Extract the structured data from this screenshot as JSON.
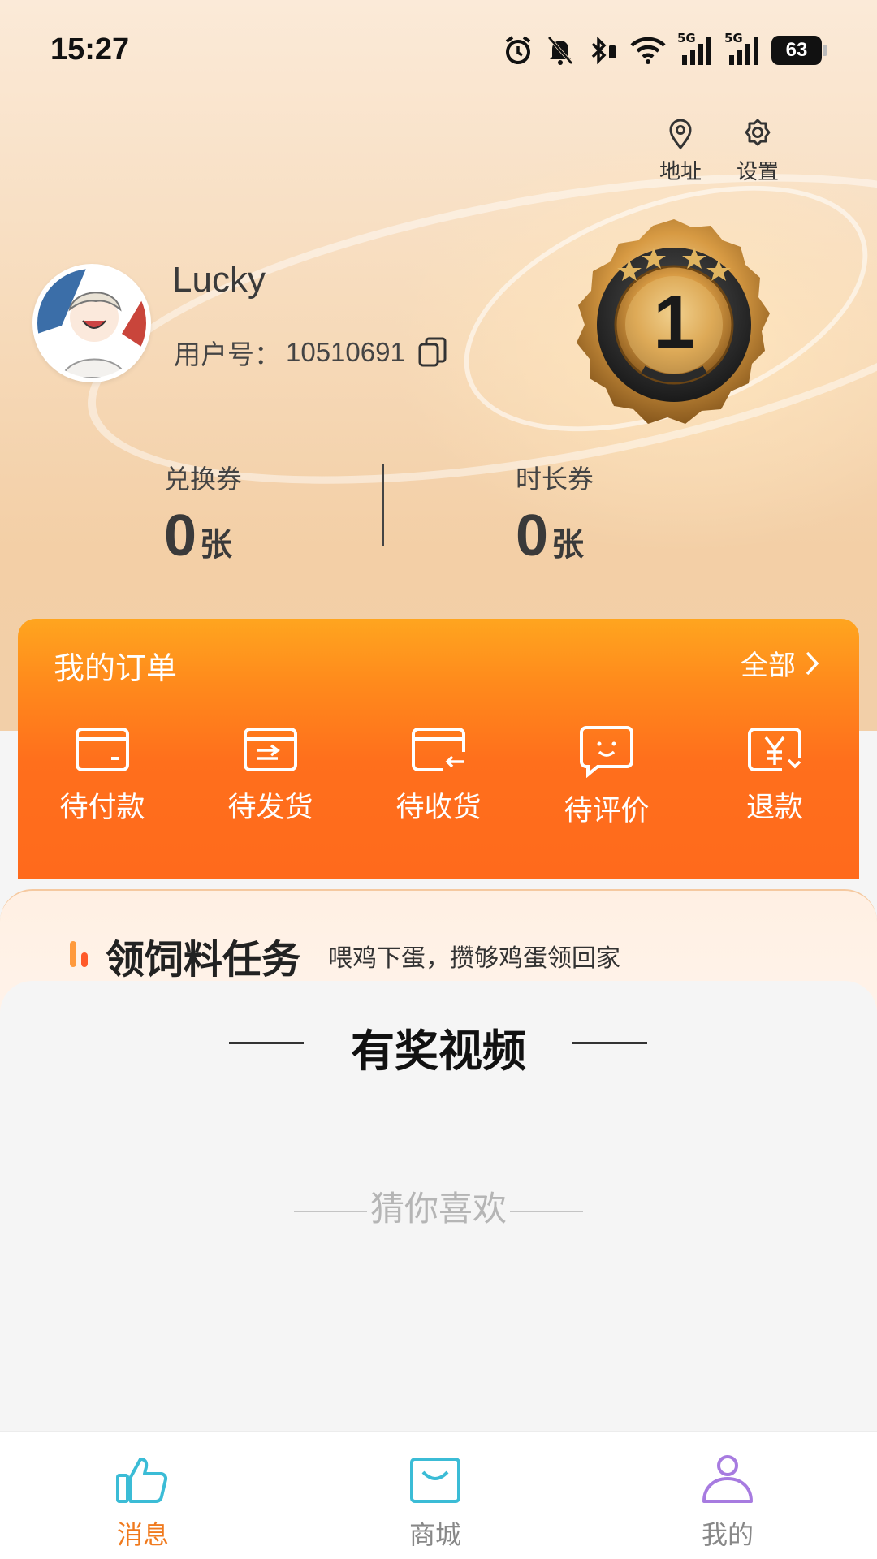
{
  "status_bar": {
    "time": "15:27",
    "network_1": "5G",
    "network_2": "5G",
    "battery": "63"
  },
  "top_actions": {
    "address_label": "地址",
    "settings_label": "设置"
  },
  "profile": {
    "username": "Lucky",
    "user_id_label": "用户号：",
    "user_id": "10510691",
    "medal_rank": "1"
  },
  "stats": [
    {
      "label": "兑换券",
      "value": "0",
      "unit": "张"
    },
    {
      "label": "时长券",
      "value": "0",
      "unit": "张"
    }
  ],
  "orders": {
    "title": "我的订单",
    "all_label": "全部",
    "items": [
      {
        "label": "待付款",
        "icon": "wallet-icon"
      },
      {
        "label": "待发货",
        "icon": "ship-box-icon"
      },
      {
        "label": "待收货",
        "icon": "receive-card-icon"
      },
      {
        "label": "待评价",
        "icon": "comment-smile-icon"
      },
      {
        "label": "退款",
        "icon": "refund-yen-icon"
      }
    ]
  },
  "task": {
    "title": "领饲料任务",
    "subtitle": "喂鸡下蛋，攒够鸡蛋领回家"
  },
  "reward_video": {
    "title": "有奖视频"
  },
  "guess": {
    "title": "猜你喜欢"
  },
  "tabbar": {
    "items": [
      {
        "label": "消息",
        "icon": "thumbs-up-icon",
        "color": "#f07a1e"
      },
      {
        "label": "商城",
        "icon": "shopping-bag-icon",
        "color": "#888888"
      },
      {
        "label": "我的",
        "icon": "user-icon",
        "color": "#888888"
      }
    ],
    "active_index": 0
  },
  "colors": {
    "order_orange": "#ff6f1c",
    "tab_active": "#f07a1e",
    "tab_icon_teal": "#3bbcd6",
    "tab_icon_purple": "#a77be0"
  }
}
